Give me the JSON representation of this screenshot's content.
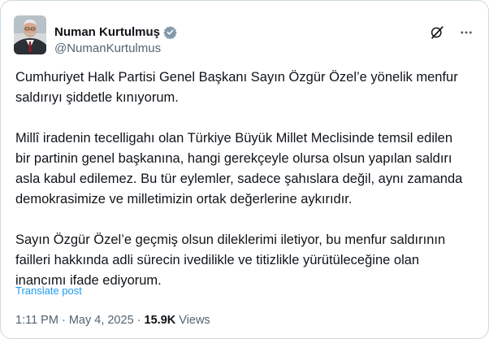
{
  "author": {
    "display_name": "Numan Kurtulmuş",
    "handle": "@NumanKurtulmus",
    "verified_badge_icon": "verified-badge-icon",
    "verified_color": "#1d9bf0"
  },
  "header_actions": {
    "grok_icon": "grok-icon",
    "more_icon": "more-options-icon"
  },
  "post": {
    "paragraphs": [
      "Cumhuriyet Halk Partisi Genel Başkanı Sayın Özgür Özel’e yönelik menfur saldırıyı şiddetle kınıyorum.",
      "Millî iradenin tecelligahı olan Türkiye Büyük Millet Meclisinde temsil edilen bir partinin genel başkanına, hangi gerekçeyle olursa olsun yapılan saldırı asla kabul edilemez. Bu tür eylemler, sadece şahıslara değil, aynı zamanda demokrasimize ve milletimizin ortak değerlerine aykırıdır.",
      "Sayın Özgür Özel’e geçmiş olsun dileklerimi iletiyor, bu menfur saldırının failleri hakkında adli sürecin ivedilikle ve titizlikle yürütüleceğine olan inancımı ifade ediyorum."
    ],
    "translate_label": "Translate post"
  },
  "meta": {
    "time": "1:11 PM",
    "separator": " · ",
    "date": "May 4, 2025",
    "views_count": "15.9K",
    "views_label": "Views"
  },
  "colors": {
    "text_primary": "#0f1419",
    "text_secondary": "#536471",
    "accent": "#1d9bf0",
    "border": "#cfd9de"
  }
}
